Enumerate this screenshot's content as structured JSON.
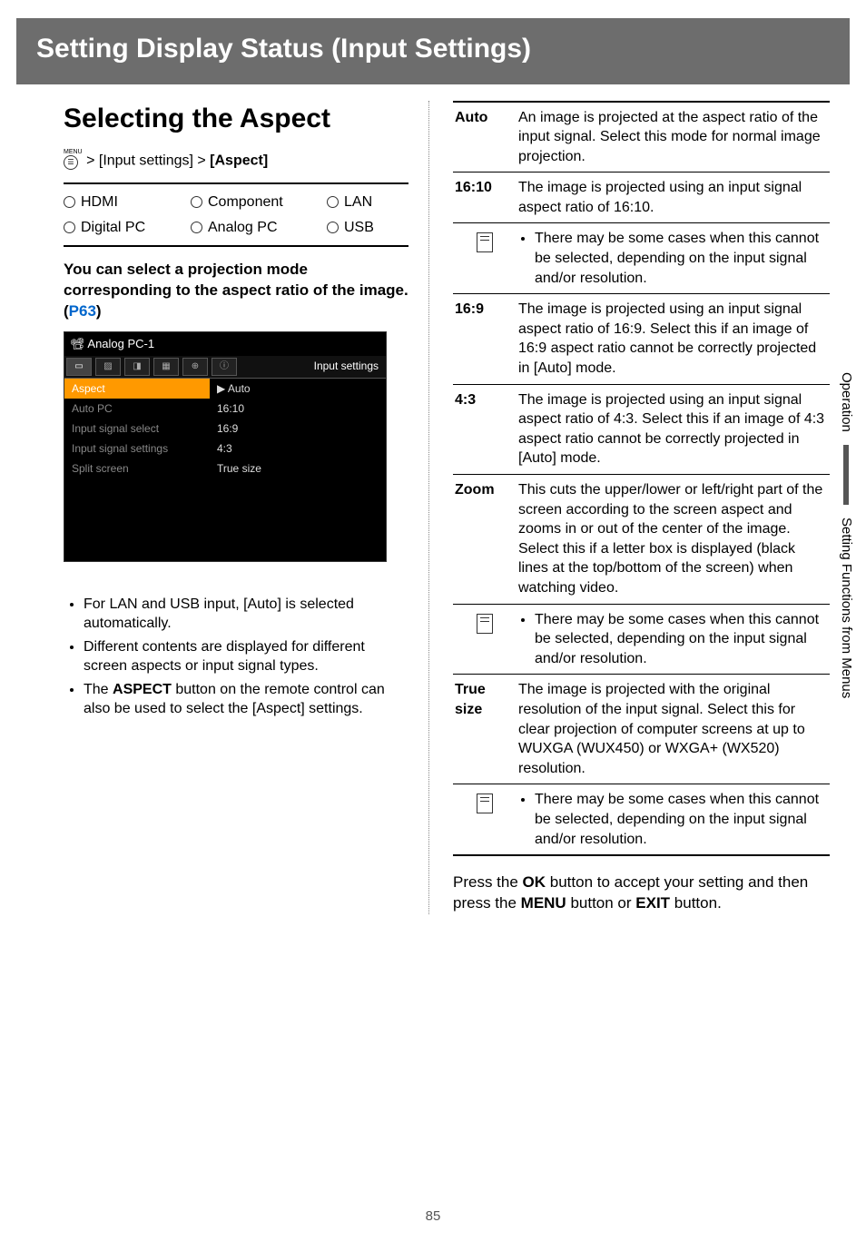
{
  "header": {
    "title": "Setting Display Status (Input Settings)"
  },
  "section": {
    "title": "Selecting the Aspect"
  },
  "breadcrumb": {
    "menu_label": "MENU",
    "path1": " > [Input settings] > ",
    "target": "[Aspect]"
  },
  "inputs": {
    "row1": [
      "HDMI",
      "Component",
      "LAN"
    ],
    "row2": [
      "Digital PC",
      "Analog PC",
      "USB"
    ]
  },
  "intro": {
    "text_pre": "You can select a projection mode corresponding to the aspect ratio of the image. (",
    "link": "P63",
    "text_post": ")"
  },
  "osd": {
    "title": "Analog PC-1",
    "tabs_right": "Input settings",
    "tabs": [
      "▭",
      "▨",
      "◨",
      "▦",
      "⊕",
      "ⓘ"
    ],
    "left_items": [
      "Aspect",
      "Auto PC",
      "Input signal select",
      "Input signal settings",
      "Split screen"
    ],
    "right_items": [
      "▶ Auto",
      "16:10",
      "16:9",
      "4:3",
      "True size"
    ]
  },
  "left_bullets": [
    "For LAN and USB input, [Auto] is selected automatically.",
    "Different contents are displayed for different screen aspects or input signal types.",
    "The ASPECT button on the remote control can also be used to select the [Aspect] settings."
  ],
  "left_bullet3_pre": "The ",
  "left_bullet3_bold": "ASPECT",
  "left_bullet3_post": " button on the remote control can also be used to select the [Aspect] settings.",
  "options": [
    {
      "label": "Auto",
      "desc": "An image is projected at the aspect ratio of the input signal. Select this mode for normal image projection."
    },
    {
      "label": "16:10",
      "desc": "The image is projected using an input signal aspect ratio of 16:10."
    },
    {
      "note": "There may be some cases when this cannot be selected, depending on the input signal and/or resolution."
    },
    {
      "label": "16:9",
      "desc": "The image is projected using an input signal aspect ratio of 16:9. Select this if an image of 16:9 aspect ratio cannot be correctly projected in [Auto] mode."
    },
    {
      "label": "4:3",
      "desc": "The image is projected using an input signal aspect ratio of 4:3. Select this if an image of 4:3 aspect ratio cannot be correctly projected in [Auto] mode."
    },
    {
      "label": "Zoom",
      "desc": "This cuts the upper/lower or left/right part of the screen according to the screen aspect and zooms in or out of the center of the image. Select this if a letter box is displayed (black lines at the top/bottom of the screen) when watching video."
    },
    {
      "note": "There may be some cases when this cannot be selected, depending on the input signal and/or resolution."
    },
    {
      "label": "True size",
      "desc": "The image is projected with the original resolution of the input signal. Select this for clear projection of computer screens at up to WUXGA (WUX450) or WXGA+ (WX520) resolution."
    },
    {
      "note": "There may be some cases when this cannot be selected, depending on the input signal and/or resolution."
    }
  ],
  "closing": {
    "pre": "Press the ",
    "b1": "OK",
    "mid1": " button to accept your setting and then press the ",
    "b2": "MENU",
    "mid2": " button or ",
    "b3": "EXIT",
    "post": " button."
  },
  "side_tab": {
    "t1": "Operation",
    "t2": "Setting Functions from Menus"
  },
  "page_number": "85"
}
